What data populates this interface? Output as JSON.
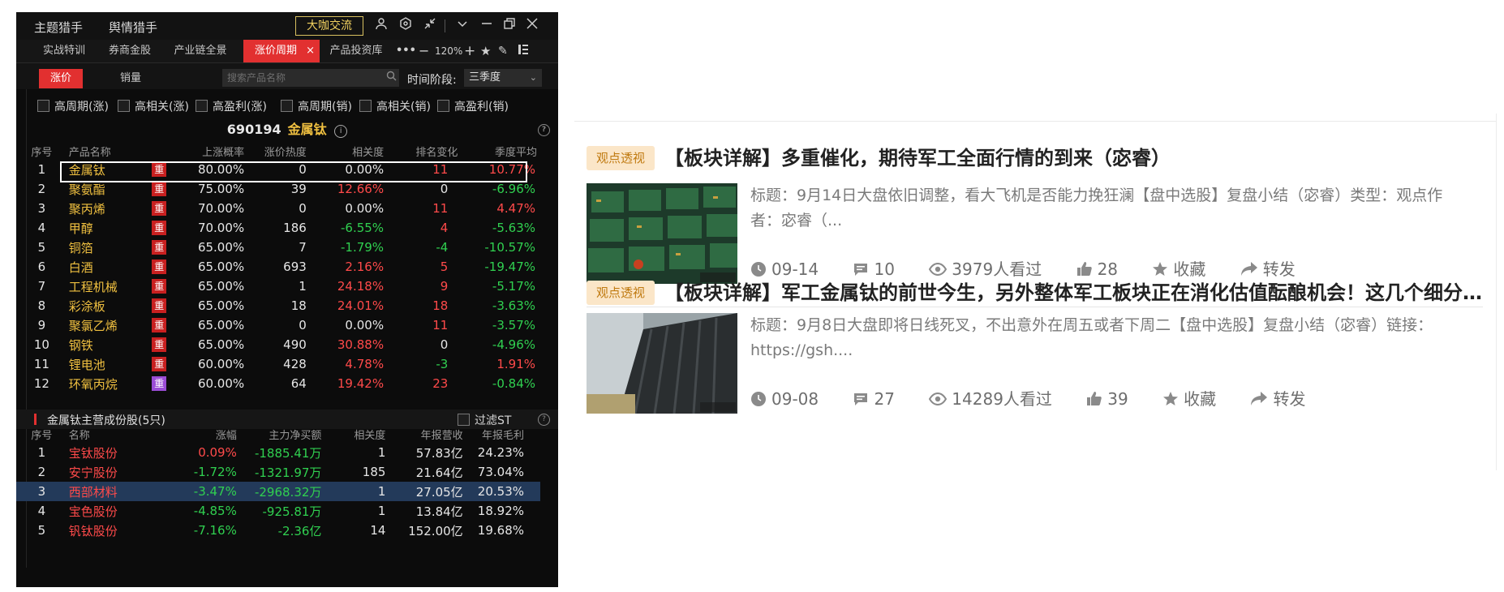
{
  "titlebar": {
    "tabs": [
      "主题猎手",
      "舆情猎手"
    ],
    "highlight_button": "大咖交流"
  },
  "tabs": {
    "items": [
      "实战特训",
      "券商金股",
      "产业链全景",
      "涨价周期",
      "产品投资库"
    ],
    "active": "涨价周期",
    "zoom": "120%"
  },
  "filter": {
    "pill_active": "涨价",
    "pill_other": "销量",
    "search_placeholder": "搜索产品名称",
    "stage_label": "时间阶段:",
    "stage_value": "三季度"
  },
  "checkboxes": [
    "高周期(涨)",
    "高相关(涨)",
    "高盈利(涨)",
    "高周期(销)",
    "高相关(销)",
    "高盈利(销)"
  ],
  "stock": {
    "code": "690194",
    "name": "金属钛",
    "info_icon": "i",
    "help_icon": "?"
  },
  "product_table": {
    "headers": [
      "序号",
      "产品名称",
      "上涨概率",
      "涨价热度",
      "相关度",
      "排名变化",
      "季度平均"
    ],
    "badge": "重",
    "rows": [
      {
        "idx": "1",
        "name": "金属钛",
        "prob": "80.00%",
        "heat": "0",
        "corr": "0.00%",
        "corr_c": "white",
        "rank": "11",
        "rank_c": "red",
        "avg": "10.77%",
        "avg_c": "red",
        "badge_color": "red"
      },
      {
        "idx": "2",
        "name": "聚氨酯",
        "prob": "75.00%",
        "heat": "39",
        "corr": "12.66%",
        "corr_c": "red",
        "rank": "0",
        "rank_c": "white",
        "avg": "-6.96%",
        "avg_c": "green",
        "badge_color": "red"
      },
      {
        "idx": "3",
        "name": "聚丙烯",
        "prob": "70.00%",
        "heat": "0",
        "corr": "0.00%",
        "corr_c": "white",
        "rank": "11",
        "rank_c": "red",
        "avg": "4.47%",
        "avg_c": "red",
        "badge_color": "red"
      },
      {
        "idx": "4",
        "name": "甲醇",
        "prob": "70.00%",
        "heat": "186",
        "corr": "-6.55%",
        "corr_c": "green",
        "rank": "4",
        "rank_c": "red",
        "avg": "-5.63%",
        "avg_c": "green",
        "badge_color": "red"
      },
      {
        "idx": "5",
        "name": "铜箔",
        "prob": "65.00%",
        "heat": "7",
        "corr": "-1.79%",
        "corr_c": "green",
        "rank": "-4",
        "rank_c": "green",
        "avg": "-10.57%",
        "avg_c": "green",
        "badge_color": "red"
      },
      {
        "idx": "6",
        "name": "白酒",
        "prob": "65.00%",
        "heat": "693",
        "corr": "2.16%",
        "corr_c": "red",
        "rank": "5",
        "rank_c": "red",
        "avg": "-19.47%",
        "avg_c": "green",
        "badge_color": "red"
      },
      {
        "idx": "7",
        "name": "工程机械",
        "prob": "65.00%",
        "heat": "1",
        "corr": "24.18%",
        "corr_c": "red",
        "rank": "9",
        "rank_c": "red",
        "avg": "-5.17%",
        "avg_c": "green",
        "badge_color": "red"
      },
      {
        "idx": "8",
        "name": "彩涂板",
        "prob": "65.00%",
        "heat": "18",
        "corr": "24.01%",
        "corr_c": "red",
        "rank": "18",
        "rank_c": "red",
        "avg": "-3.63%",
        "avg_c": "green",
        "badge_color": "red"
      },
      {
        "idx": "9",
        "name": "聚氯乙烯",
        "prob": "65.00%",
        "heat": "0",
        "corr": "0.00%",
        "corr_c": "white",
        "rank": "11",
        "rank_c": "red",
        "avg": "-3.57%",
        "avg_c": "green",
        "badge_color": "red"
      },
      {
        "idx": "10",
        "name": "钢铁",
        "prob": "65.00%",
        "heat": "490",
        "corr": "30.88%",
        "corr_c": "red",
        "rank": "0",
        "rank_c": "white",
        "avg": "-4.96%",
        "avg_c": "green",
        "badge_color": "red"
      },
      {
        "idx": "11",
        "name": "锂电池",
        "prob": "60.00%",
        "heat": "428",
        "corr": "4.78%",
        "corr_c": "red",
        "rank": "-3",
        "rank_c": "green",
        "avg": "1.91%",
        "avg_c": "red",
        "badge_color": "red"
      },
      {
        "idx": "12",
        "name": "环氧丙烷",
        "prob": "60.00%",
        "heat": "64",
        "corr": "19.42%",
        "corr_c": "red",
        "rank": "23",
        "rank_c": "red",
        "avg": "-0.84%",
        "avg_c": "green",
        "badge_color": "purple"
      }
    ]
  },
  "constituents": {
    "title": "金属钛主营成份股(5只)",
    "filter_label": "过滤ST",
    "headers": [
      "序号",
      "名称",
      "涨幅",
      "主力净买额",
      "相关度",
      "年报营收",
      "年报毛利"
    ],
    "rows": [
      {
        "idx": "1",
        "name": "宝钛股份",
        "chg": "0.09%",
        "chg_c": "red",
        "net": "-1885.41万",
        "corr": "1",
        "rev": "57.83亿",
        "gm": "24.23%",
        "hl": false
      },
      {
        "idx": "2",
        "name": "安宁股份",
        "chg": "-1.72%",
        "chg_c": "green",
        "net": "-1321.97万",
        "corr": "185",
        "rev": "21.64亿",
        "gm": "73.04%",
        "hl": false
      },
      {
        "idx": "3",
        "name": "西部材料",
        "chg": "-3.47%",
        "chg_c": "green",
        "net": "-2968.32万",
        "corr": "1",
        "rev": "27.05亿",
        "gm": "20.53%",
        "hl": true
      },
      {
        "idx": "4",
        "name": "宝色股份",
        "chg": "-4.85%",
        "chg_c": "green",
        "net": "-925.81万",
        "corr": "1",
        "rev": "13.84亿",
        "gm": "18.92%",
        "hl": false
      },
      {
        "idx": "5",
        "name": "钒钛股份",
        "chg": "-7.16%",
        "chg_c": "green",
        "net": "-2.36亿",
        "corr": "14",
        "rev": "152.00亿",
        "gm": "19.68%",
        "hl": false
      }
    ]
  },
  "feed": [
    {
      "badge": "观点透视",
      "title": "【板块详解】多重催化，期待军工全面行情的到来（宓睿）",
      "summary": "标题：9月14日大盘依旧调整，看大飞机是否能力挽狂澜【盘中选股】复盘小结（宓睿）类型：观点作者：宓睿（...",
      "date": "09-14",
      "comments": "10",
      "views": "3979人看过",
      "likes": "28",
      "fav": "收藏",
      "share": "转发"
    },
    {
      "badge": "观点透视",
      "title": "【板块详解】军工金属钛的前世今生，另外整体军工板块正在消化估值酝酿机会！这几个细分值得关注",
      "summary": "标题：9月8日大盘即将日线死叉，不出意外在周五或者下周二【盘中选股】复盘小结（宓睿）链接：https://gsh....",
      "date": "09-08",
      "comments": "27",
      "views": "14289人看过",
      "likes": "39",
      "fav": "收藏",
      "share": "转发"
    }
  ],
  "colors": {
    "accent_red": "#e23030",
    "up_red": "#ff4a4a",
    "down_green": "#30d050",
    "gold": "#f0c040",
    "badge_bg": "#fbe6c8"
  }
}
